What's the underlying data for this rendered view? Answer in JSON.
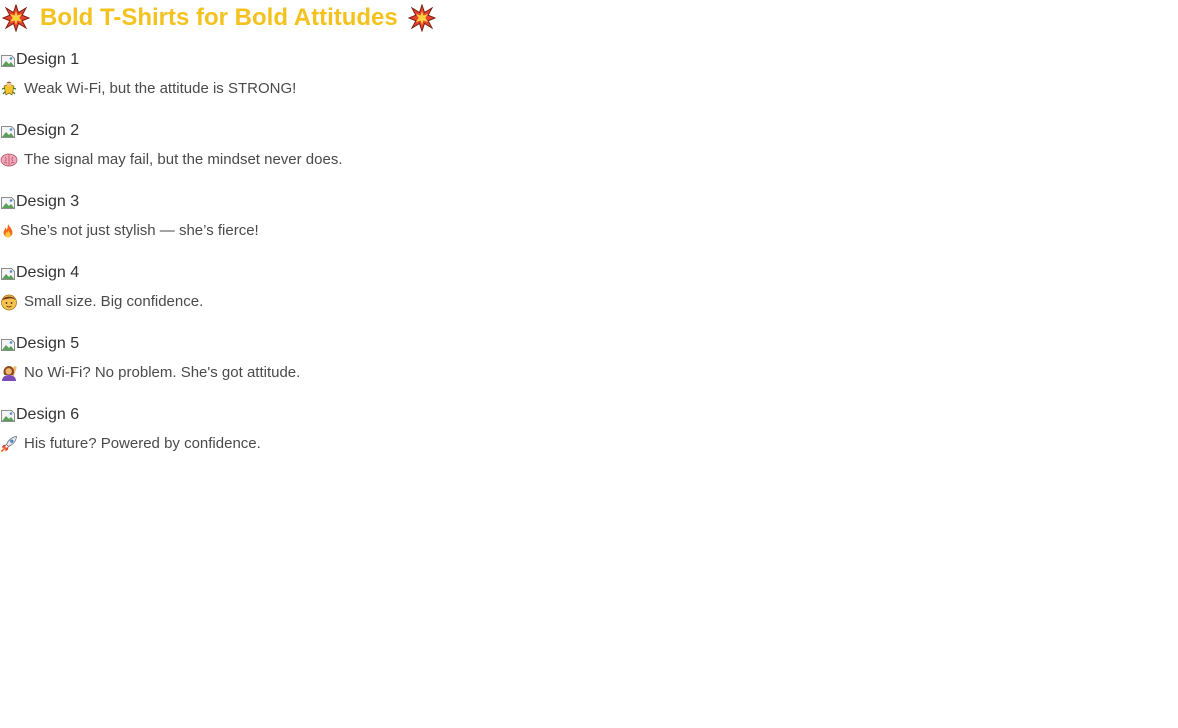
{
  "page": {
    "title": "Bold T-Shirts for Bold Attitudes",
    "title_color": "#f4c21f",
    "title_icon": "collision-icon"
  },
  "designs": [
    {
      "alt": "Design 1",
      "caption": "Weak Wi-Fi, but the attitude is STRONG!",
      "icon": "woman-superhero-icon"
    },
    {
      "alt": "Design 2",
      "caption": "The signal may fail, but the mindset never does.",
      "icon": "brain-icon"
    },
    {
      "alt": "Design 3",
      "caption": "She’s not just stylish — she’s fierce!",
      "icon": "fire-icon"
    },
    {
      "alt": "Design 4",
      "caption": "Small size. Big confidence.",
      "icon": "boy-icon"
    },
    {
      "alt": "Design 5",
      "caption": "No Wi-Fi? No problem. She's got attitude.",
      "icon": "woman-raising-hand-icon"
    },
    {
      "alt": "Design 6",
      "caption": "His future? Powered by confidence.",
      "icon": "rocket-icon"
    }
  ]
}
